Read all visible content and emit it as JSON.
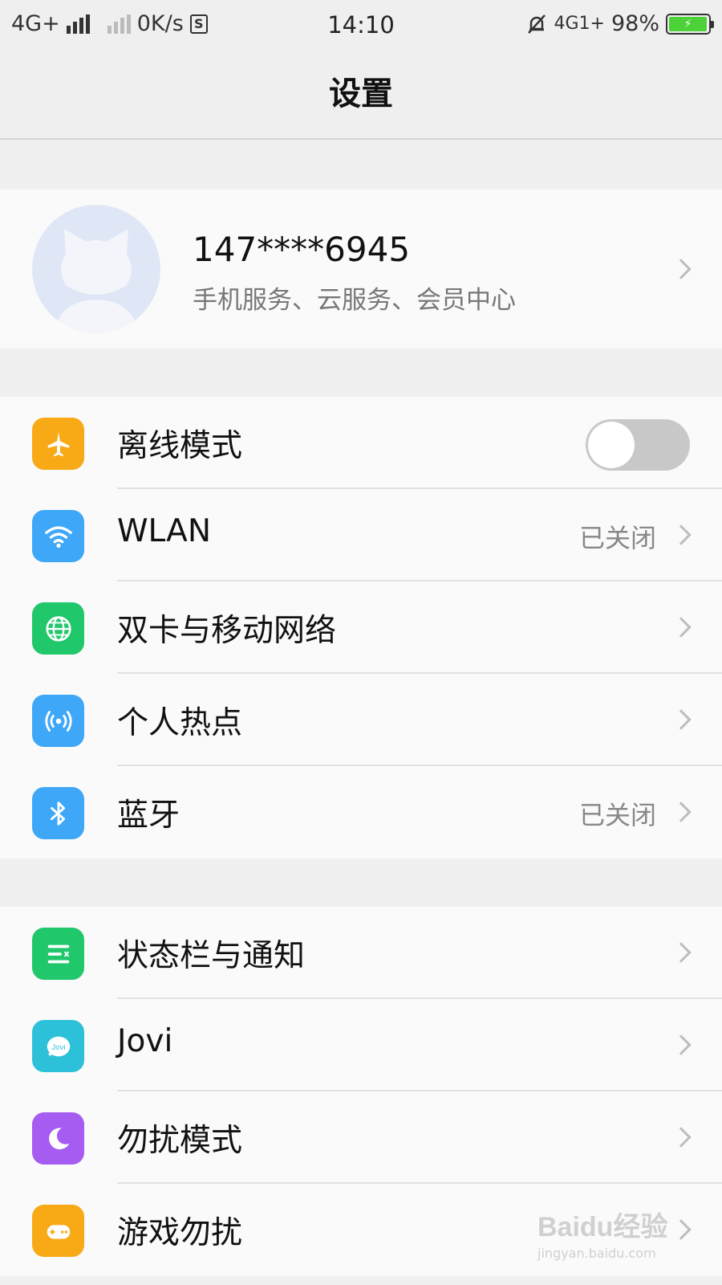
{
  "status_bar": {
    "network_left": "4G+",
    "speed": "0K/s",
    "s_icon": "S",
    "time": "14:10",
    "network_right": "4G1+",
    "battery_percent": "98%",
    "battery_level": 0.98,
    "icons": [
      "signal-icon",
      "signal-icon",
      "s-box-icon",
      "mute-bell-icon",
      "battery-charging-icon"
    ]
  },
  "header": {
    "title": "设置"
  },
  "account": {
    "phone": "147****6945",
    "subtitle": "手机服务、云服务、会员中心",
    "avatar_icon": "cat-avatar-icon"
  },
  "group1": {
    "items": [
      {
        "label": "离线模式",
        "icon": "airplane-icon",
        "color": "#f8a916",
        "toggle": false
      },
      {
        "label": "WLAN",
        "icon": "wifi-icon",
        "color": "#3ea7f7",
        "value": "已关闭"
      },
      {
        "label": "双卡与移动网络",
        "icon": "globe-icon",
        "color": "#20c76b"
      },
      {
        "label": "个人热点",
        "icon": "hotspot-icon",
        "color": "#3ea7f7"
      },
      {
        "label": "蓝牙",
        "icon": "bluetooth-icon",
        "color": "#3ea7f7",
        "value": "已关闭"
      }
    ]
  },
  "group2": {
    "items": [
      {
        "label": "状态栏与通知",
        "icon": "notification-list-icon",
        "color": "#20c76b"
      },
      {
        "label": "Jovi",
        "icon": "jovi-icon",
        "color": "#2cc1d8"
      },
      {
        "label": "勿扰模式",
        "icon": "moon-icon",
        "color": "#a65cf0"
      },
      {
        "label": "游戏勿扰",
        "icon": "gamepad-icon",
        "color": "#f8a916"
      }
    ]
  },
  "watermark": {
    "logo": "Baidu经验",
    "url": "jingyan.baidu.com"
  }
}
